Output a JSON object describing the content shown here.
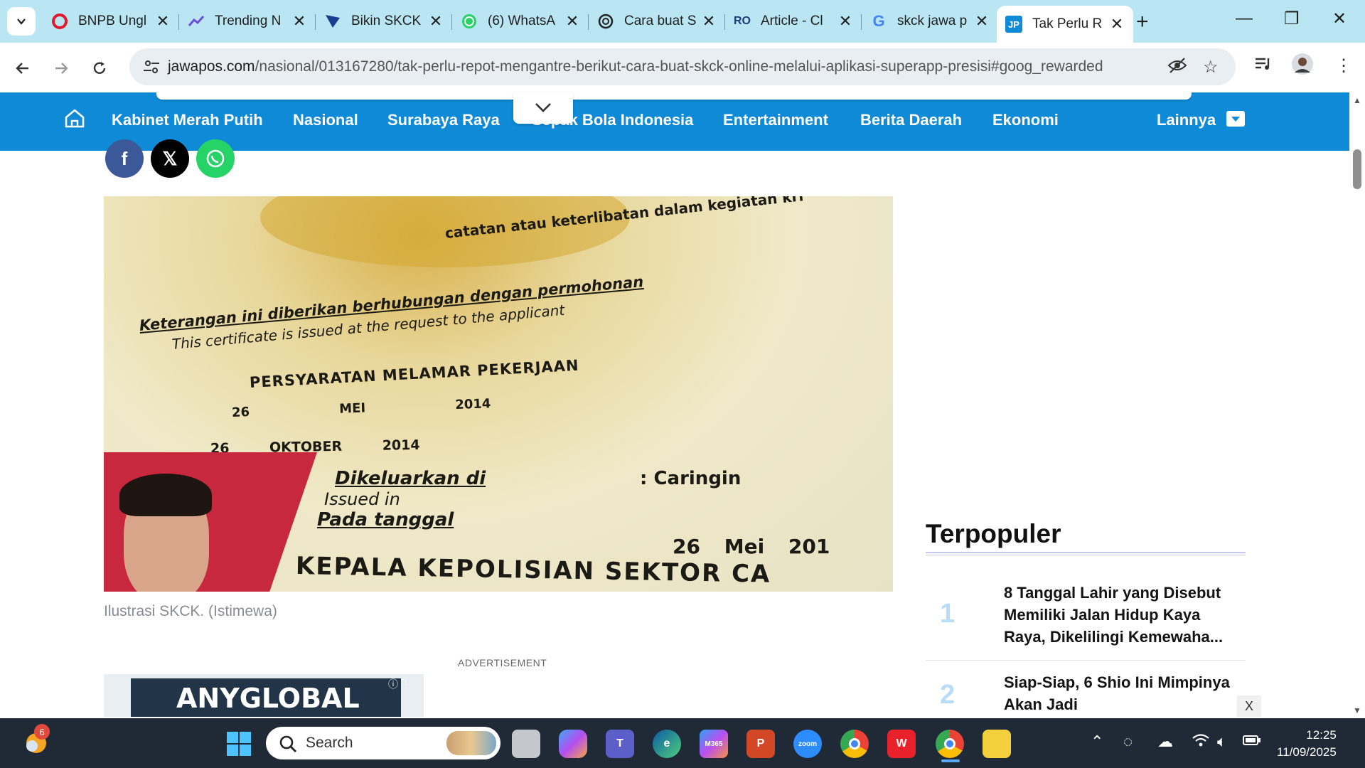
{
  "browser": {
    "tabs": [
      {
        "title": "BNPB Ungl",
        "favicon": "opera-icon",
        "color": "#e0192d"
      },
      {
        "title": "Trending N",
        "favicon": "trending-icon",
        "color": "#6b4fd8"
      },
      {
        "title": "Bikin SKCK",
        "favicon": "kite-icon",
        "color": "#1a3f8f"
      },
      {
        "title": "(6) WhatsA",
        "favicon": "whatsapp-icon",
        "color": "#25d366"
      },
      {
        "title": "Cara buat S",
        "favicon": "chatgpt-icon",
        "color": "#222222"
      },
      {
        "title": "Article - Cl",
        "favicon": "ro-icon",
        "color": "#1b3d7a"
      },
      {
        "title": "skck jawa p",
        "favicon": "google-icon",
        "color": "#4285f4"
      },
      {
        "title": "Tak Perlu R",
        "favicon": "jp-icon",
        "color": "#0f8ad6"
      }
    ],
    "active_tab_index": 7,
    "url_host": "jawapos.com",
    "url_path": "/nasional/013167280/tak-perlu-repot-mengantre-berikut-cara-buat-skck-online-melalui-aplikasi-superapp-presisi#goog_rewarded"
  },
  "site_nav": {
    "items": [
      "Kabinet Merah Putih",
      "Nasional",
      "Surabaya Raya",
      "Sepak Bola Indonesia",
      "Entertainment",
      "Berita Daerah",
      "Ekonomi"
    ],
    "more_label": "Lainnya",
    "brand_color": "#0f8ad6"
  },
  "article": {
    "hero_text": {
      "line1": "Keterangan ini diberikan berhubungan dengan permohonan",
      "line2": "This certificate is issued at the request to the applicant",
      "line3": "PERSYARATAN MELAMAR PEKERJAAN",
      "line4": "26 MEI 2014",
      "line5": "26 OKTOBER 2014",
      "line6": "Dikeluarkan di",
      "line7": ": Caringin",
      "line8": "Issued in",
      "line9": "Pada tanggal",
      "line10": "26 Mei 201",
      "line11": "KEPALA KEPOLISIAN SEKTOR CA",
      "line12": "catatan atau keterlibatan dalam kegiatan kri"
    },
    "caption": "Ilustrasi SKCK. (Istimewa)",
    "ad_label": "ADVERTISEMENT",
    "ad_text": "ANYGLOBAL"
  },
  "sidebar": {
    "title": "Terpopuler",
    "items": [
      {
        "rank": "1",
        "text": "8 Tanggal Lahir yang Disebut Memiliki Jalan Hidup Kaya Raya, Dikelilingi Kemewaha..."
      },
      {
        "rank": "2",
        "text": "Siap-Siap, 6 Shio Ini Mimpinya Akan Jadi"
      }
    ],
    "close_label": "X"
  },
  "taskbar": {
    "search_label": "Search",
    "weather_badge": "6",
    "time": "12:25",
    "date": "11/09/2025"
  }
}
